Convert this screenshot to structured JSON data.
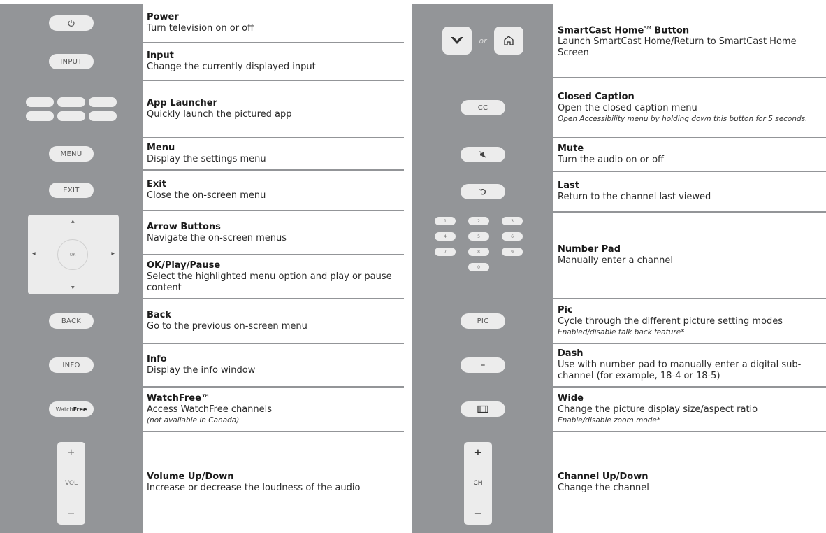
{
  "left": [
    {
      "key": "power",
      "icon": "power-icon",
      "title": "Power",
      "desc": "Turn television on or off"
    },
    {
      "key": "input",
      "button_label": "INPUT",
      "title": "Input",
      "desc": "Change the currently displayed input"
    },
    {
      "key": "app-launcher",
      "title": "App Launcher",
      "desc": "Quickly launch the pictured app"
    },
    {
      "key": "menu",
      "button_label": "MENU",
      "title": "Menu",
      "desc": "Display the settings menu"
    },
    {
      "key": "exit",
      "button_label": "EXIT",
      "title": "Exit",
      "desc": "Close the on-screen menu"
    },
    {
      "key": "arrow",
      "title": "Arrow Buttons",
      "desc": "Navigate the on-screen menus"
    },
    {
      "key": "ok",
      "dpad_center_label": "OK",
      "title": "OK/Play/Pause",
      "desc": "Select the highlighted menu option and play or pause content"
    },
    {
      "key": "back",
      "button_label": "BACK",
      "title": "Back",
      "desc": "Go to the previous on-screen menu"
    },
    {
      "key": "info",
      "button_label": "INFO",
      "title": "Info",
      "desc": "Display the info window"
    },
    {
      "key": "watchfree",
      "button_label_a": "Watch",
      "button_label_b": "Free",
      "title": "WatchFree™",
      "desc": "Access WatchFree channels",
      "note": "(not available in Canada)"
    },
    {
      "key": "volume",
      "rocker_label": "VOL",
      "rocker_plus": "+",
      "rocker_minus": "−",
      "title": "Volume Up/Down",
      "desc": "Increase or decrease the loudness of the audio"
    }
  ],
  "right": [
    {
      "key": "smartcast",
      "or_text": "or",
      "icon_a": "vizio-v-icon",
      "icon_b": "home-icon",
      "title": "SmartCast Home",
      "title_sup": "SM",
      "title_suffix": " Button",
      "desc": "Launch SmartCast Home/Return to SmartCast Home Screen"
    },
    {
      "key": "cc",
      "button_label": "CC",
      "title": "Closed Caption",
      "desc": "Open the closed caption menu",
      "note": "Open Accessibility menu by holding down this button for 5 seconds."
    },
    {
      "key": "mute",
      "icon": "mute-icon",
      "title": "Mute",
      "desc": "Turn the audio on or off"
    },
    {
      "key": "last",
      "icon": "last-channel-icon",
      "title": "Last",
      "desc": "Return to the channel last viewed"
    },
    {
      "key": "numpad",
      "keys": [
        "1",
        "2",
        "3",
        "4",
        "5",
        "6",
        "7",
        "8",
        "9",
        "0"
      ],
      "title": "Number Pad",
      "desc": "Manually enter a channel"
    },
    {
      "key": "pic",
      "button_label": "PIC",
      "title": "Pic",
      "desc": "Cycle through the different picture setting modes",
      "note": "Enabled/disable talk back feature*"
    },
    {
      "key": "dash",
      "button_label": "–",
      "title": "Dash",
      "desc": "Use with number pad to manually enter a digital sub-channel (for example, 18-4 or 18-5)"
    },
    {
      "key": "wide",
      "icon": "wide-aspect-icon",
      "title": "Wide",
      "desc": "Change the picture display size/aspect ratio",
      "note": "Enable/disable zoom mode*"
    },
    {
      "key": "channel",
      "rocker_label": "CH",
      "rocker_plus": "+",
      "rocker_minus": "−",
      "title": "Channel Up/Down",
      "desc": "Change the channel"
    }
  ]
}
